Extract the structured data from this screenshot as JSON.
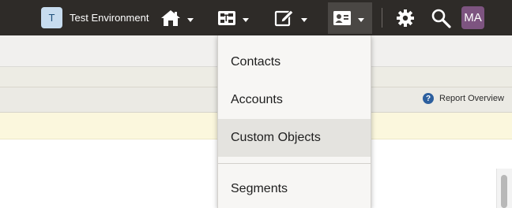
{
  "topbar": {
    "environment_initial": "T",
    "environment_name": "Test Environment",
    "avatar_initials": "MA",
    "nav": [
      {
        "name": "home-icon"
      },
      {
        "name": "orchestration-icon"
      },
      {
        "name": "assets-edit-icon"
      },
      {
        "name": "audience-card-icon"
      }
    ],
    "settings_icon": "gear-icon",
    "search_icon": "magnifier-icon"
  },
  "page": {
    "report_label": "Report Overview"
  },
  "dropdown": {
    "items": [
      "Contacts",
      "Accounts",
      "Custom Objects",
      "Segments"
    ],
    "highlighted": "Custom Objects"
  },
  "colors": {
    "topbar": "#2e2b28",
    "avatar": "#7d5480",
    "env_badge": "#c7dcef",
    "notice_band": "#fbf7dd"
  }
}
